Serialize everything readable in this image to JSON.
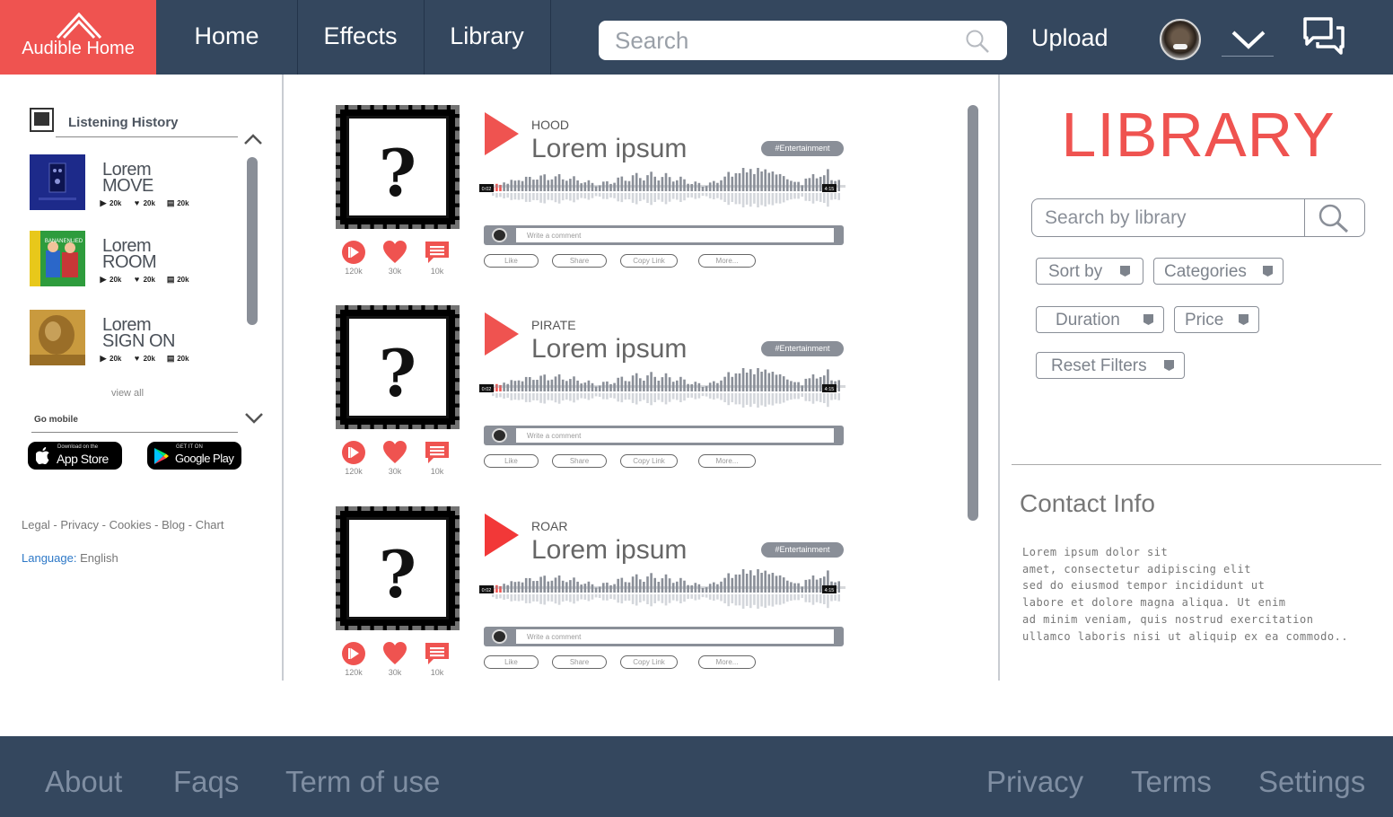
{
  "header": {
    "brand": "Audible Home",
    "nav": [
      "Home",
      "Effects",
      "Library"
    ],
    "search_placeholder": "Search",
    "upload": "Upload"
  },
  "sidebar": {
    "history_title": "Listening History",
    "items": [
      {
        "line1": "Lorem",
        "line2": "MOVE",
        "plays": "20k",
        "likes": "20k",
        "comments": "20k"
      },
      {
        "line1": "Lorem",
        "line2": "ROOM",
        "plays": "20k",
        "likes": "20k",
        "comments": "20k"
      },
      {
        "line1": "Lorem",
        "line2": "SIGN ON",
        "plays": "20k",
        "likes": "20k",
        "comments": "20k"
      }
    ],
    "thumb2_text": "BANANENLIED",
    "view_all": "view all",
    "go_mobile": "Go mobile",
    "app_store": {
      "small": "Download on the",
      "big": "App Store"
    },
    "google_play": {
      "small": "GET IT ON",
      "big": "Google Play"
    },
    "footer_links": [
      "Legal",
      "Privacy",
      "Cookies",
      "Blog",
      "Chart"
    ],
    "language_label": "Language:",
    "language_value": "English"
  },
  "feed": {
    "tracks": [
      {
        "genre": "HOOD",
        "title": "Lorem ipsum",
        "tag": "#Entertainment",
        "time_start": "0:02",
        "time_end": "4:15",
        "comment_placeholder": "Write a comment",
        "plays": "120k",
        "likes": "30k",
        "comments": "10k"
      },
      {
        "genre": "PIRATE",
        "title": "Lorem ipsum",
        "tag": "#Entertainment",
        "time_start": "0:02",
        "time_end": "4:15",
        "comment_placeholder": "Write a comment",
        "plays": "120k",
        "likes": "30k",
        "comments": "10k"
      },
      {
        "genre": "ROAR",
        "title": "Lorem ipsum",
        "tag": "#Entertainment",
        "time_start": "0:02",
        "time_end": "4:15",
        "comment_placeholder": "Write a comment",
        "plays": "120k",
        "likes": "30k",
        "comments": "10k"
      }
    ],
    "actions": [
      "Like",
      "Share",
      "Copy Link",
      "More..."
    ],
    "cover_glyph": "?"
  },
  "library": {
    "title": "LIBRARY",
    "search_placeholder": "Search by library",
    "filters": [
      "Sort by",
      "Categories",
      "Duration",
      "Price",
      "Reset Filters"
    ],
    "contact_title": "Contact Info",
    "contact_lines": [
      "Lorem ipsum dolor sit",
      "amet, consectetur adipiscing elit",
      "sed do eiusmod tempor incididunt ut",
      "labore et dolore magna aliqua. Ut enim",
      "ad minim veniam, quis nostrud exercitation",
      "ullamco laboris nisi ut aliquip ex ea commodo.."
    ]
  },
  "footer": {
    "left": [
      "About",
      "Faqs",
      "Term of use"
    ],
    "right": [
      "Privacy",
      "Terms",
      "Settings"
    ]
  },
  "colors": {
    "navy": "#34475e",
    "accent": "#ef5350",
    "gray": "#8a8f98"
  }
}
